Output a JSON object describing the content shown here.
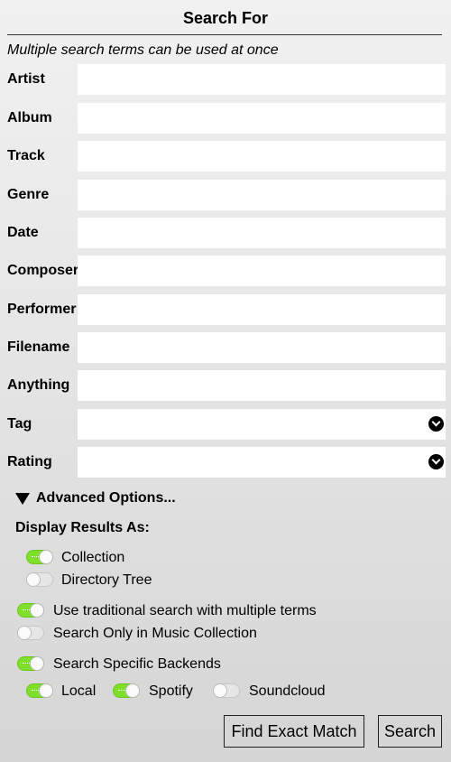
{
  "header": {
    "title": "Search For",
    "hint": "Multiple search terms can be used at once"
  },
  "fields": {
    "artist": {
      "label": "Artist",
      "value": ""
    },
    "album": {
      "label": "Album",
      "value": ""
    },
    "track": {
      "label": "Track",
      "value": ""
    },
    "genre": {
      "label": "Genre",
      "value": ""
    },
    "date": {
      "label": "Date",
      "value": ""
    },
    "composer": {
      "label": "Composer",
      "value": ""
    },
    "performer": {
      "label": "Performer",
      "value": ""
    },
    "filename": {
      "label": "Filename",
      "value": ""
    },
    "anything": {
      "label": "Anything",
      "value": ""
    }
  },
  "selects": {
    "tag": {
      "label": "Tag",
      "value": "",
      "icon": "chevron-down-circle-icon"
    },
    "rating": {
      "label": "Rating",
      "value": "",
      "icon": "chevron-down-circle-icon"
    }
  },
  "advanced": {
    "label": "Advanced Options...",
    "expanded": true,
    "icon": "triangle-down-icon",
    "display_label": "Display Results As:",
    "display_options": [
      {
        "label": "Collection",
        "on": true
      },
      {
        "label": "Directory Tree",
        "on": false
      }
    ],
    "options": [
      {
        "label": "Use traditional search with multiple terms",
        "on": true
      },
      {
        "label": "Search Only in Music Collection",
        "on": false
      },
      {
        "label": "Search Specific Backends",
        "on": true
      }
    ],
    "backends": [
      {
        "label": "Local",
        "on": true
      },
      {
        "label": "Spotify",
        "on": true
      },
      {
        "label": "Soundcloud",
        "on": false
      }
    ]
  },
  "buttons": {
    "exact_match": "Find Exact Match",
    "search": "Search"
  },
  "colors": {
    "toggle_on": "#7ee02a",
    "toggle_off": "#e6e6e6",
    "input_background": "#ffffff"
  }
}
